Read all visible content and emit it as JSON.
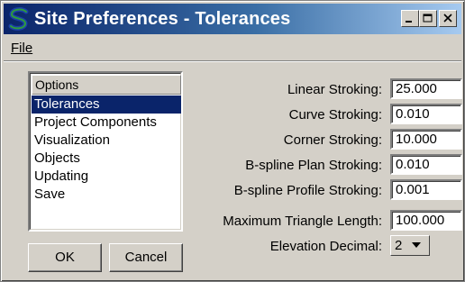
{
  "window": {
    "title": "Site Preferences - Tolerances",
    "app_icon": "logo-s-icon",
    "controls": [
      "minimize-icon",
      "maximize-icon",
      "close-icon"
    ]
  },
  "menu": {
    "file_label": "File"
  },
  "options": {
    "header": "Options",
    "items": [
      {
        "label": "Tolerances",
        "selected": true
      },
      {
        "label": "Project Components",
        "selected": false
      },
      {
        "label": "Visualization",
        "selected": false
      },
      {
        "label": "Objects",
        "selected": false
      },
      {
        "label": "Updating",
        "selected": false
      },
      {
        "label": "Save",
        "selected": false
      }
    ]
  },
  "buttons": {
    "ok": "OK",
    "cancel": "Cancel"
  },
  "fields": [
    {
      "label": "Linear Stroking:",
      "value": "25.000"
    },
    {
      "label": "Curve Stroking:",
      "value": "0.010"
    },
    {
      "label": "Corner Stroking:",
      "value": "10.000"
    },
    {
      "label": "B-spline Plan Stroking:",
      "value": "0.010"
    },
    {
      "label": "B-spline Profile Stroking:",
      "value": "0.001"
    },
    {
      "label": "Maximum Triangle Length:",
      "value": "100.000"
    }
  ],
  "elevation": {
    "label": "Elevation Decimal:",
    "value": "2"
  },
  "colors": {
    "selection": "#0a246a",
    "titlebar_start": "#0a246a",
    "titlebar_end": "#a6caf0",
    "face": "#d4d0c8",
    "icon_green": "#2e9b3e",
    "icon_blue": "#1c3fa8"
  }
}
